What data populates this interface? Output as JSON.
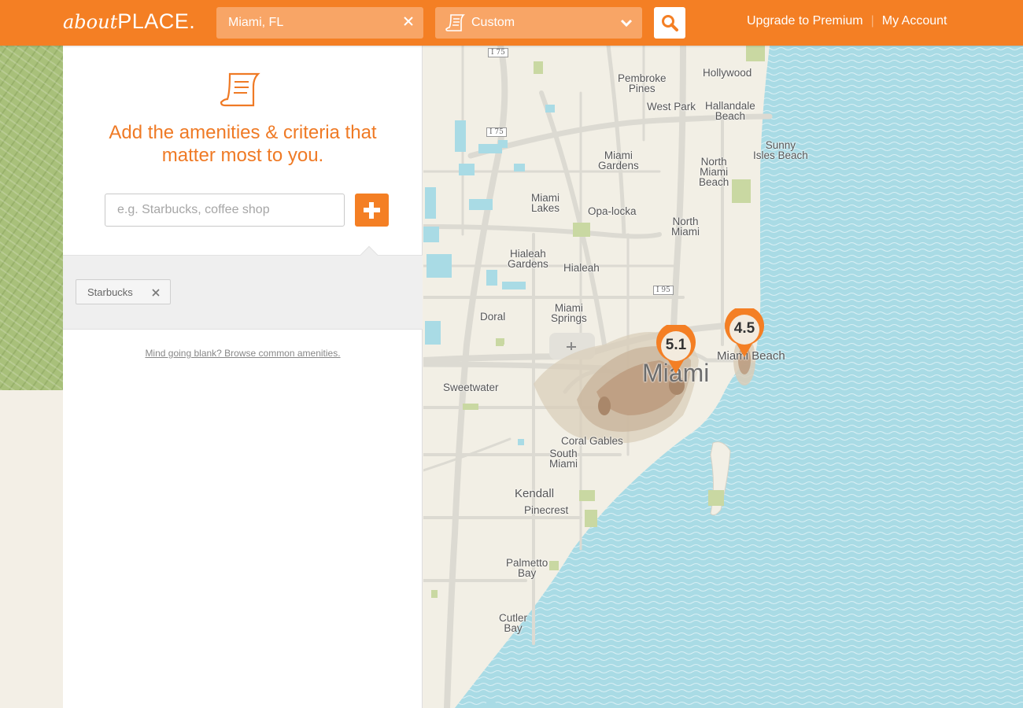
{
  "header": {
    "logo_about": "about",
    "logo_place": "PLACE.",
    "location_value": "Miami, FL",
    "preset_label": "Custom",
    "nav": {
      "upgrade": "Upgrade to Premium",
      "separator": "|",
      "account": "My Account"
    }
  },
  "panel": {
    "headline": "Add the amenities & criteria that matter most to you.",
    "input_placeholder": "e.g. Starbucks, coffee shop",
    "tags": [
      {
        "label": "Starbucks"
      }
    ],
    "browse_link": "Mind going blank? Browse common amenities."
  },
  "map": {
    "labels": {
      "hollywood": "Hollywood",
      "pembroke": "Pembroke\nPines",
      "west_park": "West Park",
      "hallandale": "Hallandale\nBeach",
      "sunny_isles": "Sunny\nIsles Beach",
      "miami_gardens": "Miami\nGardens",
      "north_miami_beach": "North\nMiami\nBeach",
      "miami_lakes": "Miami\nLakes",
      "opa_locka": "Opa-locka",
      "north_miami": "North\nMiami",
      "hialeah_gardens": "Hialeah\nGardens",
      "hialeah": "Hialeah",
      "miami_springs": "Miami\nSprings",
      "doral": "Doral",
      "miami_beach": "Miami Beach",
      "miami": "Miami",
      "sweetwater": "Sweetwater",
      "coral_gables": "Coral Gables",
      "south_miami": "South\nMiami",
      "kendall": "Kendall",
      "pinecrest": "Pinecrest",
      "palmetto_bay": "Palmetto\nBay",
      "cutler_bay": "Cutler\nBay"
    },
    "shields": {
      "i75_top": "I 75",
      "i75_mid": "I 75",
      "i95": "I 95"
    },
    "pins": [
      {
        "name": "Miami",
        "score": "5.1"
      },
      {
        "name": "Miami Beach",
        "score": "4.5"
      }
    ],
    "colors": {
      "land": "#f2efe5",
      "water": "#a9dbe5",
      "park": "#c9d8a2",
      "heat": "#b9977a",
      "pin": "#f47f24"
    }
  }
}
